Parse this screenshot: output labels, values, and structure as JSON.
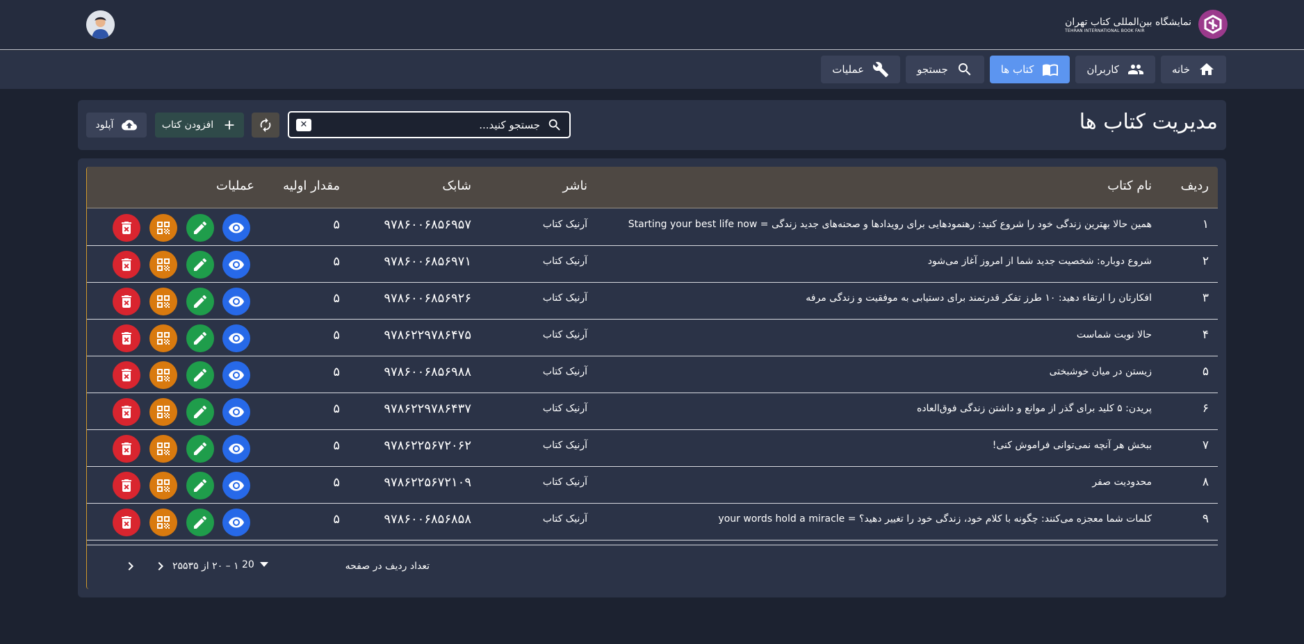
{
  "brand": {
    "title_fa": "نمایشگاه بین‌المللی کتاب تهران",
    "title_en": "TEHRAN INTERNATIONAL BOOK FAIR"
  },
  "nav": [
    {
      "label": "خانه",
      "icon": "home-icon",
      "active": false
    },
    {
      "label": "کاربران",
      "icon": "users-icon",
      "active": false
    },
    {
      "label": "کتاب ها",
      "icon": "book-icon",
      "active": true
    },
    {
      "label": "جستجو",
      "icon": "search-icon",
      "active": false
    },
    {
      "label": "عملیات",
      "icon": "wrench-icon",
      "active": false
    }
  ],
  "page": {
    "title": "مدیریت کتاب ها"
  },
  "search": {
    "placeholder": "جستجو کنید...",
    "value": ""
  },
  "toolbar": {
    "add_label": "افزودن کتاب",
    "upload_label": "آپلود"
  },
  "table": {
    "headers": {
      "index": "ردیف",
      "name": "نام کتاب",
      "publisher": "ناشر",
      "isbn": "شابک",
      "qty": "مقدار اولیه",
      "actions": "عملیات"
    },
    "rows": [
      {
        "index": "۱",
        "name": "همین حالا بهترین زندگی خود را شروع کنید: رهنمودهایی برای رویدادها و صحنه‌های جدید زندگی = Starting your best life now",
        "publisher": "آرنیک کتاب",
        "isbn": "۹۷۸۶۰۰۶۸۵۶۹۵۷",
        "qty": "۵"
      },
      {
        "index": "۲",
        "name": "شروع دوباره: شخصیت جدید شما از امروز آغاز می‌شود",
        "publisher": "آرنیک کتاب",
        "isbn": "۹۷۸۶۰۰۶۸۵۶۹۷۱",
        "qty": "۵"
      },
      {
        "index": "۳",
        "name": "افکارتان را ارتقاء دهید: ۱۰ طرز تفکر قدرتمند برای دستیابی به موفقیت و زندگی مرفه",
        "publisher": "آرنیک کتاب",
        "isbn": "۹۷۸۶۰۰۶۸۵۶۹۲۶",
        "qty": "۵"
      },
      {
        "index": "۴",
        "name": "حالا نوبت شماست",
        "publisher": "آرنیک کتاب",
        "isbn": "۹۷۸۶۲۲۹۷۸۶۴۷۵",
        "qty": "۵"
      },
      {
        "index": "۵",
        "name": "زیستن در میان خوشبختی",
        "publisher": "آرنیک کتاب",
        "isbn": "۹۷۸۶۰۰۶۸۵۶۹۸۸",
        "qty": "۵"
      },
      {
        "index": "۶",
        "name": "پریدن: ۵ کلید برای گذر از موانع و داشتن زندگی فوق‌العاده",
        "publisher": "آرنیک کتاب",
        "isbn": "۹۷۸۶۲۲۹۷۸۶۴۳۷",
        "qty": "۵"
      },
      {
        "index": "۷",
        "name": "ببخش هر آنچه نمی‌توانی فراموش کنی!",
        "publisher": "آرنیک کتاب",
        "isbn": "۹۷۸۶۲۲۵۶۷۲۰۶۲",
        "qty": "۵"
      },
      {
        "index": "۸",
        "name": "محدودیت صفر",
        "publisher": "آرنیک کتاب",
        "isbn": "۹۷۸۶۲۲۵۶۷۲۱۰۹",
        "qty": "۵"
      },
      {
        "index": "۹",
        "name": "کلمات شما معجزه می‌کنند: چگونه با کلام خود، زندگی خود را تغییر دهید؟ = your words hold a miracle",
        "publisher": "آرنیک کتاب",
        "isbn": "۹۷۸۶۰۰۶۸۵۶۸۵۸",
        "qty": "۵"
      }
    ]
  },
  "pagination": {
    "rows_per_page_label": "تعداد ردیف در صفحه",
    "rows_per_page": "20",
    "range": "۱ – ۲۰ از ۲۵۵۳۵"
  },
  "colors": {
    "view": "#2769e8",
    "edit": "#1f9d4b",
    "qr": "#d97a0f",
    "delete": "#d9252f",
    "active_nav": "#5c95f0"
  }
}
